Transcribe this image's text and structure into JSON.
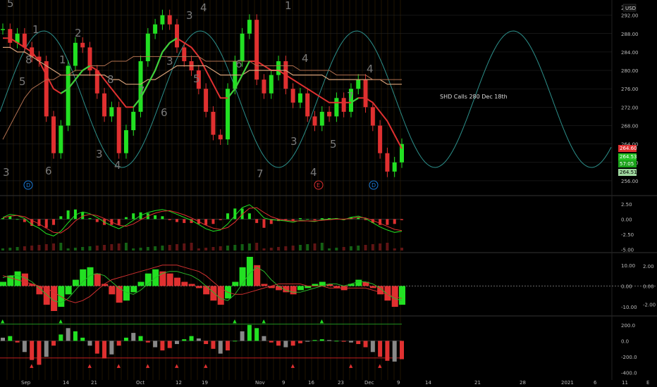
{
  "chart_data": [
    {
      "type": "candlestick",
      "panel": "price",
      "currency": "USD",
      "ylim": [
        254,
        295
      ],
      "y_ticks": [
        "292.00",
        "288.00",
        "284.00",
        "280.00",
        "276.00",
        "272.00",
        "268.00",
        "264.00",
        "260.00",
        "256.00"
      ],
      "price_tags": [
        "264.60",
        "264.53",
        "57:05",
        "264.51"
      ],
      "top_clip_label": "2",
      "annotation": "SHD Calls 280 Dec 18th",
      "series": [
        {
          "name": "",
          "values": [
            289,
            286,
            288,
            285,
            283,
            282,
            270,
            262,
            268,
            281,
            286,
            285,
            280,
            275,
            270,
            272,
            262,
            267,
            271,
            282,
            288,
            290,
            292,
            290,
            285,
            282,
            280,
            276,
            271,
            266,
            265,
            276,
            282,
            288,
            291,
            278,
            275,
            279,
            282,
            276,
            273,
            275,
            270,
            268,
            271,
            270,
            274,
            271,
            276,
            278,
            272,
            268,
            262,
            258,
            260,
            264
          ]
        },
        {
          "name": "",
          "values": [
            287,
            287,
            286,
            285,
            284,
            282,
            279,
            276,
            275,
            276,
            278,
            280,
            281,
            280,
            278,
            276,
            274,
            272,
            272,
            274,
            277,
            280,
            284,
            286,
            287,
            286,
            285,
            283,
            280,
            277,
            274,
            274,
            276,
            279,
            282,
            282,
            281,
            280,
            280,
            279,
            278,
            277,
            276,
            275,
            274,
            273,
            273,
            273,
            273,
            274,
            274,
            273,
            271,
            269,
            266,
            263
          ]
        },
        {
          "name": "",
          "values": [
            285,
            285,
            284,
            284,
            283,
            282,
            281,
            280,
            279,
            279,
            279,
            279,
            279,
            279,
            279,
            278,
            278,
            277,
            277,
            277,
            278,
            278,
            279,
            280,
            281,
            281,
            281,
            281,
            281,
            280,
            279,
            279,
            279,
            279,
            280,
            280,
            280,
            280,
            280,
            280,
            279,
            279,
            279,
            279,
            279,
            278,
            278,
            278,
            278,
            278,
            278,
            278,
            278,
            277,
            277,
            277
          ]
        },
        {
          "name": "",
          "values": [
            265,
            268,
            271,
            274,
            276,
            277,
            278,
            278,
            279,
            279,
            280,
            280,
            281,
            281,
            281,
            282,
            282,
            282,
            283,
            283,
            283,
            283,
            283,
            283,
            283,
            283,
            283,
            283,
            282,
            282,
            282,
            282,
            282,
            282,
            282,
            281,
            281,
            281,
            281,
            281,
            281,
            280,
            280,
            280,
            280,
            280,
            279,
            279,
            279,
            279,
            279,
            278,
            278,
            278,
            278,
            278
          ]
        }
      ],
      "cycle_labels": [
        "5",
        "1",
        "2",
        "3",
        "4",
        "1",
        "5",
        "6",
        "3",
        "4",
        "8",
        "6",
        "5",
        "7",
        "3",
        "4",
        "5",
        "4",
        "4",
        "3",
        "8",
        "1",
        "7",
        "3",
        "6",
        "7"
      ],
      "event_markers": [
        "D",
        "E",
        "D"
      ]
    },
    {
      "type": "oscillator",
      "panel": "osc1",
      "y_ticks": [
        "2.50",
        "0.00",
        "-2.50",
        "-5.00"
      ],
      "ylim": [
        -5.2,
        3.2
      ],
      "series": [
        {
          "name": "",
          "values": [
            0.3,
            0.8,
            0.6,
            0.1,
            -0.9,
            -1.5,
            -2.4,
            -2.8,
            -2.0,
            -0.6,
            0.7,
            1.2,
            0.9,
            0.3,
            -0.5,
            -1.1,
            -1.6,
            -1.0,
            -0.2,
            0.6,
            1.1,
            1.4,
            1.6,
            1.3,
            0.8,
            0.3,
            -0.2,
            -0.9,
            -1.6,
            -2.0,
            -1.8,
            -0.8,
            0.6,
            1.9,
            2.4,
            1.5,
            0.2,
            -0.1,
            -0.2,
            -0.3,
            -0.5,
            -0.2,
            -0.3,
            -0.4,
            -0.1,
            0.0,
            0.1,
            -0.1,
            0.3,
            0.5,
            0.1,
            -0.6,
            -1.3,
            -1.8,
            -2.2,
            -2.0
          ]
        },
        {
          "name": "",
          "values": [
            0.2,
            0.5,
            0.6,
            0.4,
            -0.2,
            -0.8,
            -1.5,
            -2.2,
            -2.3,
            -1.5,
            -0.3,
            0.5,
            0.8,
            0.6,
            0.1,
            -0.5,
            -1.0,
            -1.2,
            -0.8,
            -0.1,
            0.5,
            1.0,
            1.3,
            1.4,
            1.1,
            0.7,
            0.2,
            -0.4,
            -1.0,
            -1.5,
            -1.7,
            -1.4,
            -0.5,
            0.8,
            1.8,
            1.9,
            1.1,
            0.4,
            0.0,
            -0.2,
            -0.3,
            -0.3,
            -0.3,
            -0.3,
            -0.2,
            -0.1,
            0.0,
            0.0,
            0.1,
            0.3,
            0.2,
            -0.2,
            -0.7,
            -1.2,
            -1.7,
            -1.9
          ]
        }
      ]
    },
    {
      "type": "histogram",
      "panel": "osc2",
      "y_ticks_left": [
        "10.00",
        "0.00",
        "-10.00"
      ],
      "y_ticks_right": [
        "2.00",
        "0.00",
        "-2.00"
      ],
      "ylim": [
        -12,
        14
      ],
      "values": [
        2,
        5,
        7,
        6,
        1,
        -4,
        -9,
        -12,
        -10,
        -4,
        3,
        8,
        9,
        6,
        1,
        -4,
        -8,
        -7,
        -3,
        2,
        6,
        8,
        7,
        6,
        4,
        2,
        1,
        -1,
        -4,
        -7,
        -9,
        -6,
        2,
        9,
        14,
        10,
        1,
        -1,
        -2,
        -3,
        -4,
        -2,
        -1,
        1,
        2,
        1,
        -1,
        -2,
        1,
        3,
        2,
        -1,
        -4,
        -7,
        -10,
        -9
      ],
      "series": [
        {
          "name": "",
          "values": [
            4,
            5,
            5,
            4,
            2,
            -1,
            -4,
            -7,
            -8,
            -6,
            -2,
            2,
            5,
            6,
            5,
            2,
            -1,
            -3,
            -4,
            -2,
            1,
            4,
            6,
            7,
            7,
            6,
            5,
            3,
            0,
            -3,
            -6,
            -7,
            -4,
            1,
            6,
            9,
            7,
            3,
            0,
            -2,
            -3,
            -3,
            -2,
            -1,
            0,
            1,
            1,
            0,
            1,
            2,
            2,
            1,
            -1,
            -4,
            -6,
            -7
          ]
        },
        {
          "name": "",
          "values": [
            5,
            4,
            3,
            2,
            1,
            0,
            -1,
            -3,
            -5,
            -7,
            -8,
            -7,
            -5,
            -2,
            1,
            3,
            4,
            5,
            6,
            7,
            8,
            9,
            10,
            10,
            10,
            9,
            8,
            7,
            5,
            2,
            -1,
            -3,
            -4,
            -4,
            -3,
            -2,
            -1,
            0,
            1,
            1,
            1,
            1,
            0,
            0,
            0,
            -1,
            -1,
            -1,
            -1,
            -1,
            -1,
            -2,
            -3,
            -4,
            -5,
            -6
          ]
        }
      ]
    },
    {
      "type": "histogram",
      "panel": "osc3",
      "y_ticks": [
        "200.0",
        "0.0",
        "-200.0",
        "-400.0"
      ],
      "ylim": [
        -420,
        260
      ],
      "values": [
        40,
        60,
        -20,
        -140,
        -240,
        -300,
        -200,
        -60,
        80,
        160,
        120,
        40,
        -60,
        -160,
        -220,
        -170,
        -60,
        40,
        100,
        60,
        -20,
        -80,
        -120,
        -90,
        -40,
        20,
        60,
        30,
        -40,
        -100,
        -160,
        -120,
        0,
        120,
        200,
        160,
        60,
        -20,
        -60,
        -80,
        -60,
        -30,
        -10,
        10,
        20,
        10,
        0,
        -10,
        -20,
        -40,
        -80,
        -140,
        -200,
        -250,
        -260,
        -230
      ],
      "levels": [
        "210.0",
        "-215.0"
      ]
    }
  ],
  "x_axis": {
    "tick_labels": [
      "Sep",
      "14",
      "21",
      "Oct",
      "12",
      "19",
      "Nov",
      "9",
      "16",
      "23",
      "Dec",
      "9",
      "14",
      "21",
      "28",
      "2021",
      "6",
      "11"
    ],
    "corner_label": "E"
  }
}
